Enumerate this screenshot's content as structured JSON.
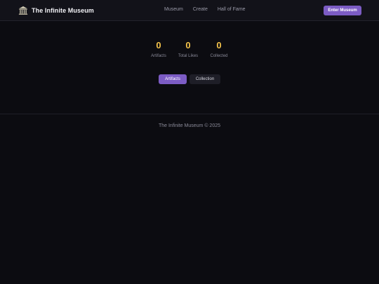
{
  "header": {
    "brand_name": "The Infinite Museum",
    "nav": [
      "Museum",
      "Create",
      "Hall of Fame"
    ],
    "cta_label": "Enter Museum"
  },
  "stats": [
    {
      "value": "0",
      "label": "Artifacts"
    },
    {
      "value": "0",
      "label": "Total Likes"
    },
    {
      "value": "0",
      "label": "Collected"
    }
  ],
  "tabs": [
    {
      "label": "Artifacts",
      "active": true
    },
    {
      "label": "Collection",
      "active": false
    }
  ],
  "footer": {
    "text": "The Infinite Museum © 2025"
  },
  "colors": {
    "accent": "#7c5cc4",
    "stat_value": "#f3c24a",
    "background": "#0c0c11",
    "header_bg": "#121219"
  },
  "icons": {
    "brand": "museum-building-icon"
  }
}
